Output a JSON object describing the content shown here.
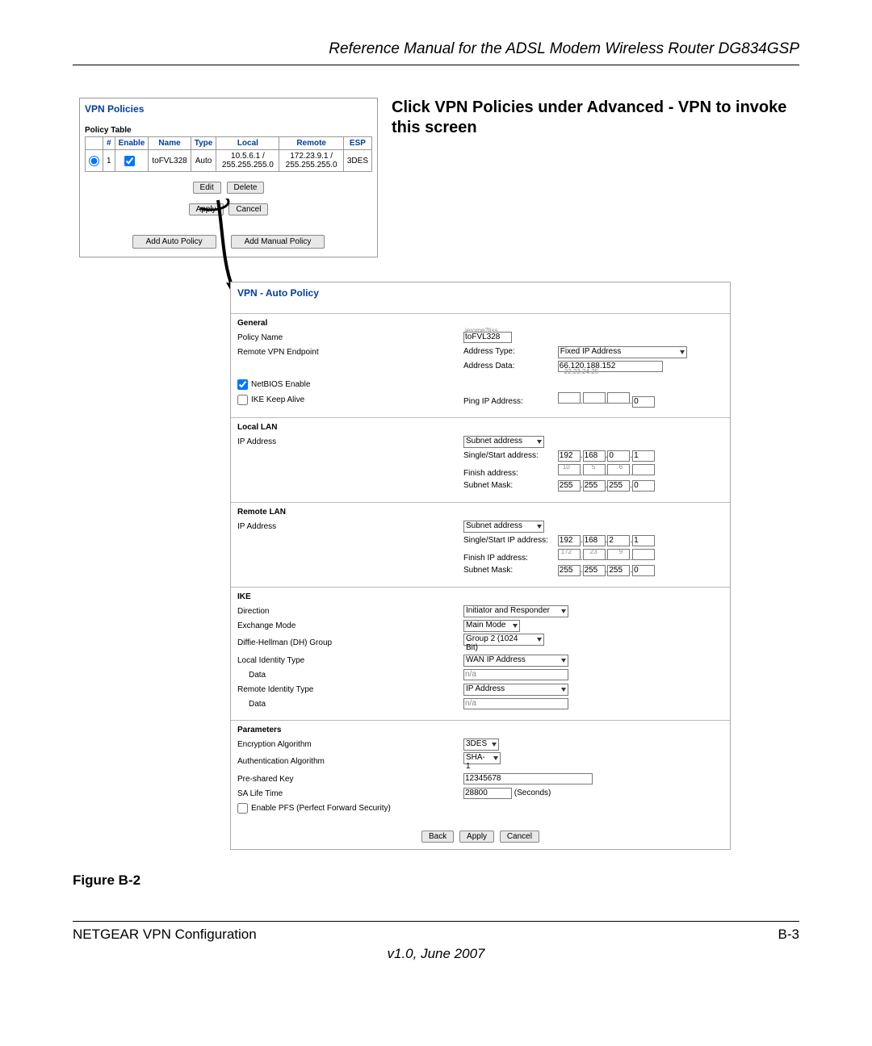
{
  "header": "Reference Manual for the ADSL Modem Wireless Router DG834GSP",
  "instruction": "Click VPN Policies under Advanced - VPN to invoke this screen",
  "vpn_policies": {
    "title": "VPN Policies",
    "table_label": "Policy Table",
    "headers": {
      "num": "#",
      "enable": "Enable",
      "name": "Name",
      "type": "Type",
      "local": "Local",
      "remote": "Remote",
      "esp": "ESP"
    },
    "row": {
      "num": "1",
      "name": "toFVL328",
      "type": "Auto",
      "local": "10.5.6.1 / 255.255.255.0",
      "remote": "172.23.9.1 / 255.255.255.0",
      "esp": "3DES"
    },
    "buttons": {
      "edit": "Edit",
      "delete": "Delete",
      "apply": "Apply",
      "cancel": "Cancel",
      "add_auto": "Add Auto Policy",
      "add_manual": "Add Manual Policy"
    }
  },
  "auto_policy": {
    "title": "VPN - Auto Policy",
    "general": {
      "heading": "General",
      "policy_name_label": "Policy Name",
      "policy_name_value": "toFVL328",
      "policy_name_ghost": "jerome2liss",
      "remote_endpoint_label": "Remote VPN Endpoint",
      "address_type_label": "Address Type:",
      "address_type_value": "Fixed IP Address",
      "address_data_label": "Address Data:",
      "address_data_value": "66.120.188.152",
      "address_data_ghost": "22.23.24.25",
      "netbios_label": "NetBIOS Enable",
      "ike_keepalive_label": "IKE Keep Alive",
      "ping_label": "Ping IP Address:"
    },
    "local_lan": {
      "heading": "Local LAN",
      "ip_label": "IP Address",
      "type": "Subnet address",
      "single_label": "Single/Start address:",
      "single": [
        "192",
        "168",
        "0",
        "1"
      ],
      "finish_label": "Finish address:",
      "finish_ghost": [
        "10",
        "5",
        "6",
        ""
      ],
      "mask_label": "Subnet Mask:",
      "mask": [
        "255",
        "255",
        "255",
        "0"
      ]
    },
    "remote_lan": {
      "heading": "Remote LAN",
      "ip_label": "IP Address",
      "type": "Subnet address",
      "single_label": "Single/Start IP address:",
      "single": [
        "192",
        "168",
        "2",
        "1"
      ],
      "finish_label": "Finish IP address:",
      "finish_ghost": [
        "172",
        "23",
        "9",
        ""
      ],
      "mask_label": "Subnet Mask:",
      "mask": [
        "255",
        "255",
        "255",
        "0"
      ]
    },
    "ike": {
      "heading": "IKE",
      "direction_label": "Direction",
      "direction": "Initiator and Responder",
      "exchange_label": "Exchange Mode",
      "exchange": "Main Mode",
      "dh_label": "Diffie-Hellman (DH) Group",
      "dh": "Group 2 (1024 Bit)",
      "local_id_label": "Local Identity Type",
      "local_id": "WAN IP Address",
      "local_data_label": "Data",
      "local_data": "n/a",
      "remote_id_label": "Remote Identity Type",
      "remote_id": "IP Address",
      "remote_data_label": "Data",
      "remote_data": "n/a"
    },
    "params": {
      "heading": "Parameters",
      "enc_label": "Encryption Algorithm",
      "enc": "3DES",
      "auth_label": "Authentication Algorithm",
      "auth": "SHA-1",
      "psk_label": "Pre-shared Key",
      "psk": "12345678",
      "sa_label": "SA Life Time",
      "sa": "28800",
      "sa_unit": "(Seconds)",
      "pfs_label": "Enable PFS (Perfect Forward Security)"
    },
    "buttons": {
      "back": "Back",
      "apply": "Apply",
      "cancel": "Cancel"
    }
  },
  "figure": "Figure B-2",
  "footer": {
    "left": "NETGEAR VPN Configuration",
    "right": "B-3",
    "version": "v1.0, June 2007"
  }
}
